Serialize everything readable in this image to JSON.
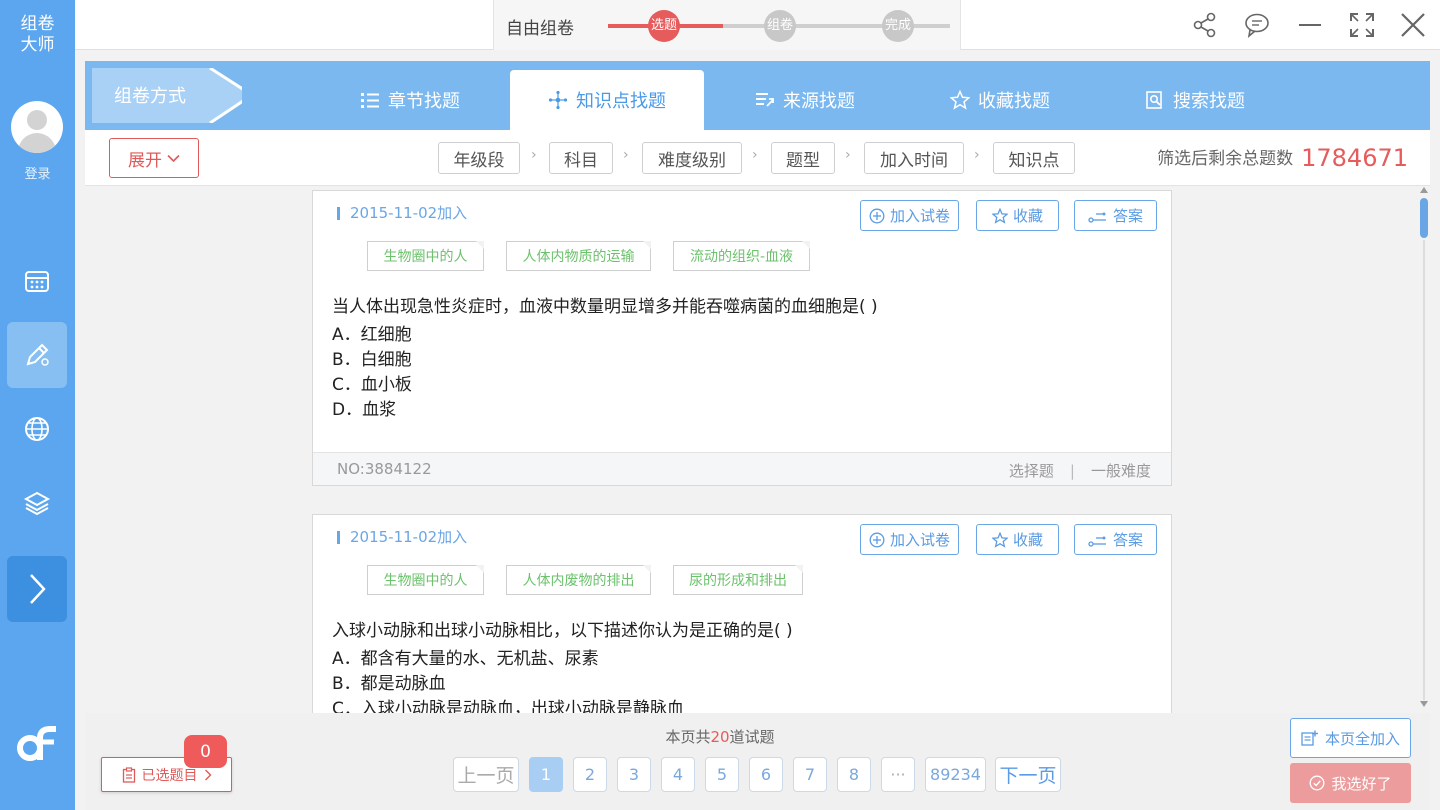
{
  "app": {
    "brand": "组卷\n大师",
    "login_label": "登录"
  },
  "header": {
    "mode_title": "自由组卷",
    "steps": [
      {
        "label": "选题",
        "color": "#e65b5b",
        "active": true
      },
      {
        "label": "组卷",
        "color": "#c8c8c8",
        "active": false
      },
      {
        "label": "完成",
        "color": "#c8c8c8",
        "active": false
      }
    ],
    "icons": [
      "share-icon",
      "chat-icon",
      "minimize-icon",
      "fullscreen-icon",
      "close-icon"
    ]
  },
  "nav": {
    "zujuan_label": "组卷方式",
    "tabs": [
      {
        "label": "章节找题",
        "icon": "list-icon"
      },
      {
        "label": "知识点找题",
        "icon": "knowledge-icon",
        "active": true
      },
      {
        "label": "来源找题",
        "icon": "source-icon"
      },
      {
        "label": "收藏找题",
        "icon": "star-icon"
      },
      {
        "label": "搜索找题",
        "icon": "search-icon"
      }
    ]
  },
  "filters": {
    "expand_label": "展开",
    "chips": [
      "年级段",
      "科目",
      "难度级别",
      "题型",
      "加入时间",
      "知识点"
    ],
    "remaining_label": "筛选后剩余总题数",
    "remaining_count": "1784671"
  },
  "questions": [
    {
      "date": "2015-11-02加入",
      "buttons": {
        "add": "加入试卷",
        "fav": "收藏",
        "answer": "答案"
      },
      "tags": [
        "生物圈中的人",
        "人体内物质的运输",
        "流动的组织-血液"
      ],
      "stem": "当人体出现急性炎症时，血液中数量明显增多并能吞噬病菌的血细胞是(   )",
      "options": [
        "A．红细胞",
        "B．白细胞",
        "C．血小板",
        "D．血浆"
      ],
      "no": "NO:3884122",
      "type": "选择题",
      "difficulty": "一般难度"
    },
    {
      "date": "2015-11-02加入",
      "buttons": {
        "add": "加入试卷",
        "fav": "收藏",
        "answer": "答案"
      },
      "tags": [
        "生物圈中的人",
        "人体内废物的排出",
        "尿的形成和排出"
      ],
      "stem": "入球小动脉和出球小动脉相比，以下描述你认为是正确的是(       )",
      "options": [
        "A．都含有大量的水、无机盐、尿素",
        "B．都是动脉血",
        "C．入球小动脉是动脉血，出球小动脉是静脉血"
      ]
    }
  ],
  "footer": {
    "page_info_pre": "本页共",
    "page_info_count": "20",
    "page_info_post": "道试题",
    "selected_label": "已选题目",
    "selected_count": "0",
    "prev": "上一页",
    "next": "下一页",
    "pages": [
      "1",
      "2",
      "3",
      "4",
      "5",
      "6",
      "7",
      "8",
      "···",
      "89234"
    ],
    "current_page": "1",
    "add_all": "本页全加入",
    "done": "我选好了"
  }
}
